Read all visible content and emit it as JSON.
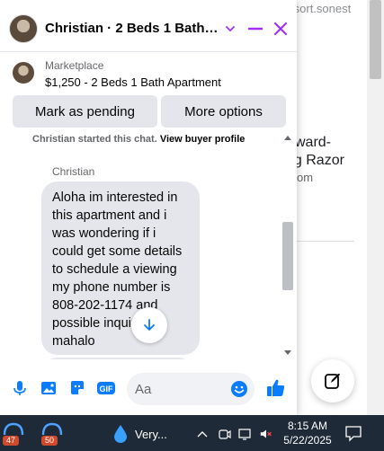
{
  "background_page": {
    "url_fragment": "kauairesort.sonest",
    "headline_line1": "ward-",
    "headline_line2": "ng Razor",
    "sub": "om"
  },
  "chat": {
    "title": "Christian · 2 Beds 1 Bath A...",
    "listing": {
      "source": "Marketplace",
      "title": "$1,250 - 2 Beds 1 Bath Apartment"
    },
    "buttons": {
      "mark_pending": "Mark as pending",
      "more_options": "More options"
    },
    "messages": {
      "started_prefix": "Christian started this chat.",
      "started_link": "View buyer profile",
      "sender": "Christian",
      "body": "Aloha im interested in this apartment and i was wondering if i could get some details to schedule a viewing my phone number is 808-202-1174 and possible inquiries mahalo"
    },
    "composer": {
      "placeholder": "Aa"
    }
  },
  "taskbar": {
    "app1_badge": "47",
    "app2_badge": "50",
    "weather_text": "Very...",
    "time": "8:15 AM",
    "date": "5/22/2025"
  },
  "colors": {
    "accent": "#a033ff",
    "messenger_blue": "#0a7cff",
    "taskbar": "#1f2a38"
  }
}
